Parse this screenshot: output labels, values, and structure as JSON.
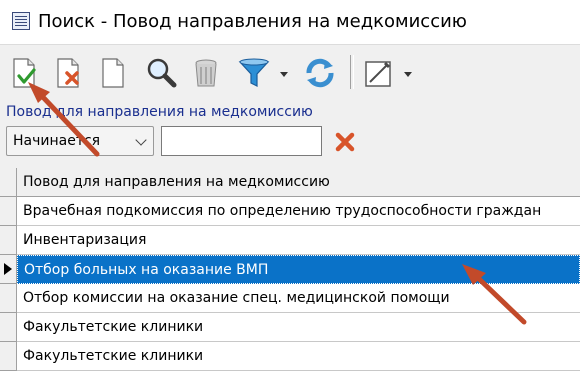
{
  "window": {
    "title": "Поиск - Повод направления на медкомиссию"
  },
  "toolbar": {
    "buttons": [
      {
        "name": "select-check-button",
        "icon": "document-check-icon"
      },
      {
        "name": "delete-button",
        "icon": "document-delete-icon"
      },
      {
        "name": "new-button",
        "icon": "blank-document-icon"
      },
      {
        "name": "search-button",
        "icon": "magnifier-icon"
      },
      {
        "name": "trash-button",
        "icon": "trash-icon"
      },
      {
        "name": "filter-button",
        "icon": "funnel-icon"
      },
      {
        "name": "refresh-button",
        "icon": "refresh-icon"
      },
      {
        "name": "edit-button",
        "icon": "edit-frame-icon"
      }
    ]
  },
  "filter": {
    "label": "Повод для направления на медкомиссию",
    "mode": "Начинается",
    "value": "",
    "clear_icon": "red-x-icon"
  },
  "grid": {
    "header": "Повод для направления на медкомиссию",
    "rows": [
      "Врачебная подкомиссия по определению трудоспособности граждан",
      "Инвентаризация",
      "Отбор больных на оказание ВМП",
      "Отбор комиссии на оказание спец. медицинской помощи",
      "Факультетские клиники",
      "Факультетские клиники"
    ],
    "selected_row": "Отбор больных на оказание ВМП"
  },
  "colors": {
    "selection": "#0a72c8",
    "annotation_arrow": "#c24a2a",
    "label": "#1a2f8f"
  }
}
